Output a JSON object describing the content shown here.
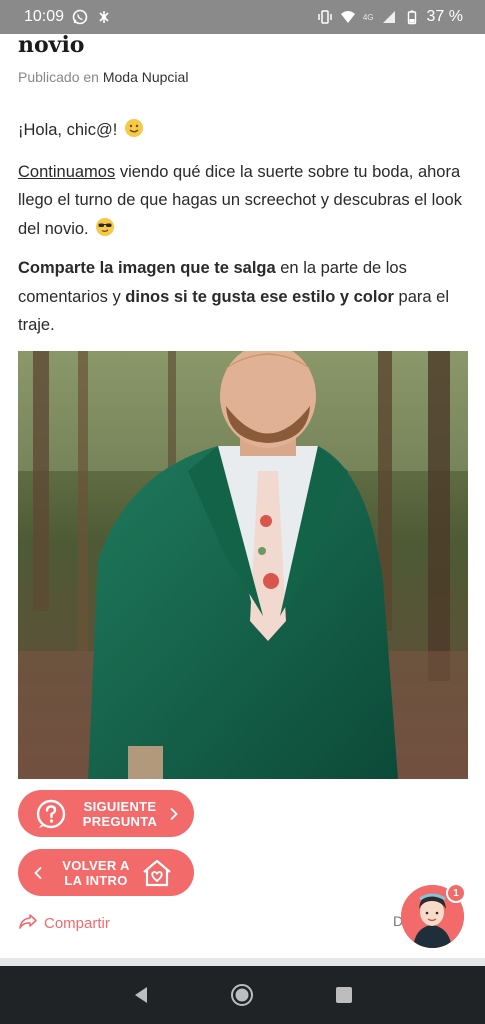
{
  "status_bar": {
    "time": "10:09",
    "network_label": "4G",
    "battery": "37 %"
  },
  "article": {
    "title": "novio",
    "meta_prefix": "Publicado en",
    "meta_category": "Moda Nupcial",
    "greeting": "¡Hola, chic@!",
    "p2_link": "Continuamos",
    "p2_text": " viendo qué dice la suerte sobre tu boda, ahora llego el turno de que hagas un screechot y descubras el look del novio.",
    "p3_b1": "Comparte la imagen que te salga",
    "p3_t1": " en la parte de los comentarios y ",
    "p3_b2": "dinos si te gusta ese estilo y color",
    "p3_t2": " para el traje."
  },
  "buttons": {
    "next_line1": "SIGUIENTE",
    "next_line2": "PREGUNTA",
    "back_line1": "VOLVER A",
    "back_line2": "LA INTRO"
  },
  "share": {
    "label": "Compartir"
  },
  "partial_label": "D",
  "avatar_badge": "1",
  "colors": {
    "accent": "#f26a6a",
    "status_bar": "#8a8a8a",
    "nav_bar": "#202326"
  },
  "icons": [
    "whatsapp-icon",
    "bug-icon",
    "vibrate-icon",
    "wifi-icon",
    "signal-icon",
    "battery-icon",
    "smile-emoji-icon",
    "sunglasses-emoji-icon",
    "question-icon",
    "chevron-right-icon",
    "chevron-left-icon",
    "house-heart-icon",
    "share-icon",
    "back-nav-icon",
    "home-nav-icon",
    "recents-nav-icon"
  ]
}
